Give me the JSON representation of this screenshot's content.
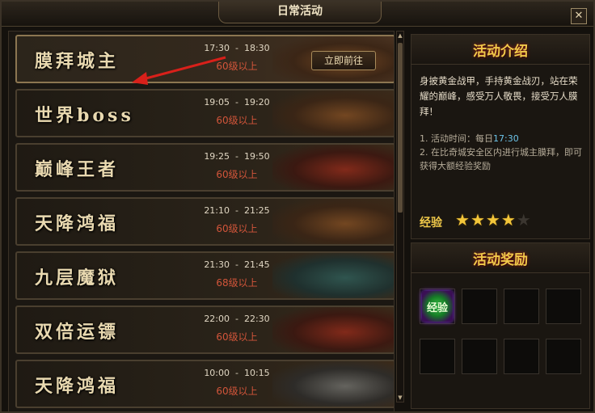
{
  "window": {
    "title": "日常活动",
    "close": "✕"
  },
  "activities": [
    {
      "name": "膜拜城主",
      "time": "17:30  -  18:30",
      "level": "60级以上",
      "button": "立即前往"
    },
    {
      "name": "世界boss",
      "time": "19:05  -  19:20",
      "level": "60级以上"
    },
    {
      "name": "巅峰王者",
      "time": "19:25  -  19:50",
      "level": "60级以上"
    },
    {
      "name": "天降鸿福",
      "time": "21:10  -  21:25",
      "level": "60级以上"
    },
    {
      "name": "九层魔狱",
      "time": "21:30  -  21:45",
      "level": "68级以上"
    },
    {
      "name": "双倍运镖",
      "time": "22:00  -  22:30",
      "level": "60级以上"
    },
    {
      "name": "天降鸿福",
      "time": "10:00  -  10:15",
      "level": "60级以上"
    }
  ],
  "info": {
    "title": "活动介绍",
    "description": "身披黄金战甲，手持黄金战刃，站在荣耀的巅峰，感受万人敬畏，接受万人膜拜！",
    "rule1_prefix": "1. 活动时间：每日",
    "rule1_time": "17:30",
    "rule2": "2. 在比奇城安全区内进行城主膜拜，即可获得大额经验奖励",
    "exp_label": "经验",
    "exp_rating": 4,
    "exp_max": 5
  },
  "rewards": {
    "title": "活动奖励",
    "item_label": "经验"
  },
  "colors": {
    "accent_gold": "#f0c94a",
    "level_red": "#d2553a",
    "time_blue": "#6cc3e8",
    "pointer_red": "#d8201a"
  }
}
